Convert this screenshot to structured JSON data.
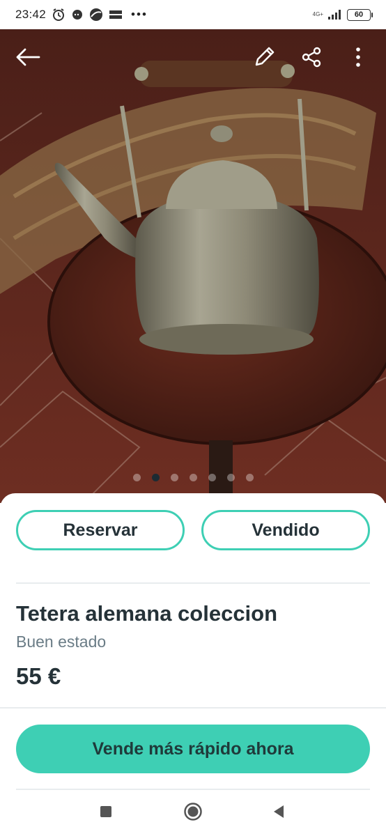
{
  "status_bar": {
    "time": "23:42",
    "more": "•••",
    "network": "4G+",
    "battery": "60"
  },
  "photo": {
    "description_icons": [
      "back-arrow-icon",
      "edit-pencil-icon",
      "share-icon",
      "more-vertical-icon"
    ],
    "carousel_count": 7,
    "carousel_active": 1
  },
  "actions": {
    "reserve": "Reservar",
    "sold": "Vendido"
  },
  "item": {
    "title": "Tetera alemana coleccion",
    "condition": "Buen estado",
    "price": "55 €"
  },
  "cta": {
    "label": "Vende más rápido ahora"
  },
  "colors": {
    "accent": "#3ecfb4",
    "text": "#253238",
    "muted": "#6a7c86"
  }
}
